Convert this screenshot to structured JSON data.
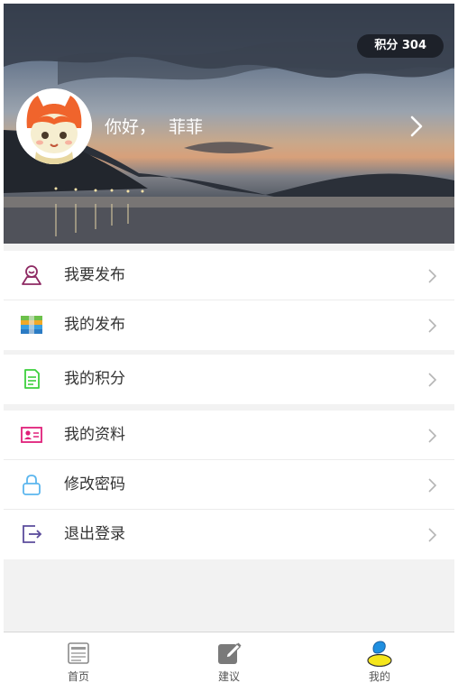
{
  "header": {
    "points_label": "积分 304",
    "greeting": "你好，",
    "username": "菲菲"
  },
  "menu": {
    "group1": [
      {
        "label": "我要发布",
        "icon": "publish-icon"
      },
      {
        "label": "我的发布",
        "icon": "my-posts-icon"
      }
    ],
    "group2": [
      {
        "label": "我的积分",
        "icon": "points-document-icon"
      }
    ],
    "group3": [
      {
        "label": "我的资料",
        "icon": "profile-card-icon"
      },
      {
        "label": "修改密码",
        "icon": "lock-icon"
      },
      {
        "label": "退出登录",
        "icon": "logout-icon"
      }
    ]
  },
  "tabbar": {
    "tabs": [
      {
        "label": "首页",
        "icon": "home-news-icon"
      },
      {
        "label": "建议",
        "icon": "edit-suggestion-icon"
      },
      {
        "label": "我的",
        "icon": "user-profile-icon",
        "active": true
      }
    ]
  },
  "colors": {
    "publish_icon": "#8e2a63",
    "points_icon": "#3ccf3c",
    "profile_icon": "#e0207a",
    "lock_icon": "#5bb6ee",
    "logout_icon": "#5b4c9c",
    "active_tab_yellow": "#f5e61b",
    "active_tab_blue": "#1f8fe0"
  }
}
